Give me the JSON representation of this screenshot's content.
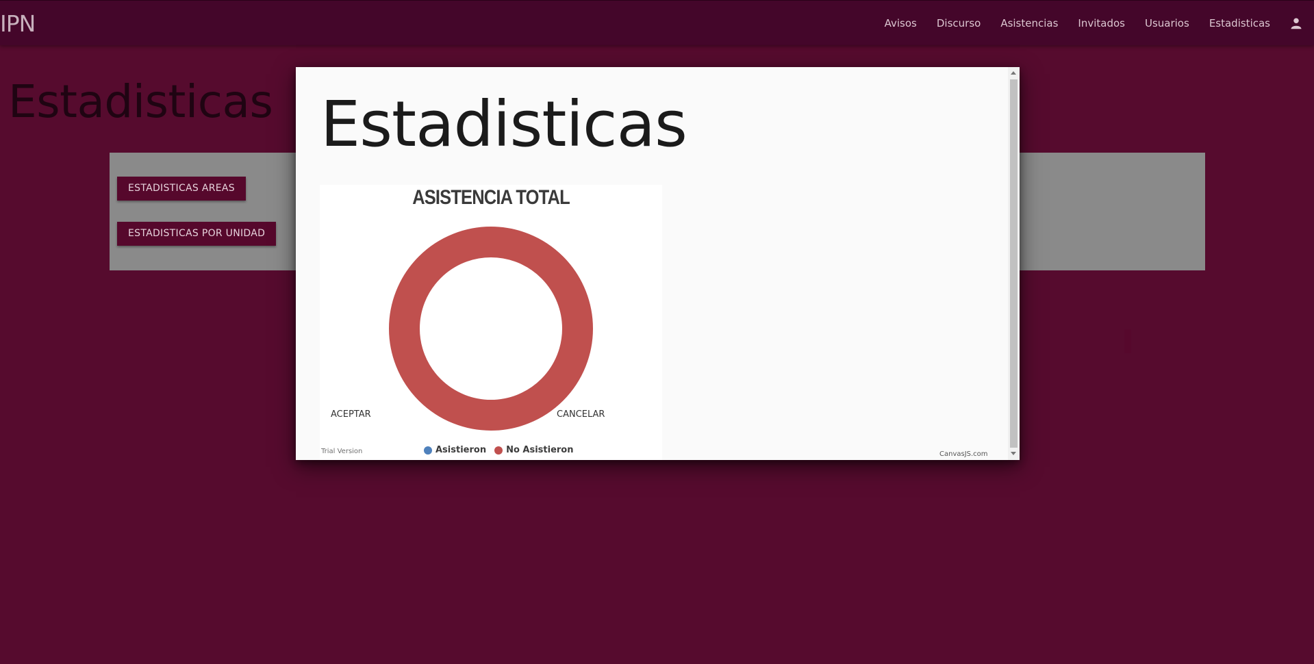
{
  "navbar": {
    "brand": "IPN",
    "links": [
      {
        "label": "Avisos"
      },
      {
        "label": "Discurso"
      },
      {
        "label": "Asistencias"
      },
      {
        "label": "Invitados"
      },
      {
        "label": "Usuarios"
      },
      {
        "label": "Estadisticas"
      }
    ],
    "user_icon": "person-icon"
  },
  "page": {
    "title": "Estadisticas",
    "buttons": {
      "areas": "ESTADISTICAS AREAS",
      "unidad": "ESTADISTICAS POR UNIDAD"
    }
  },
  "modal": {
    "title": "Estadisticas",
    "accept": "ACEPTAR",
    "cancel": "CANCELAR",
    "trial": "Trial Version",
    "credit": "CanvasJS.com"
  },
  "chart_data": {
    "type": "pie",
    "subtype": "doughnut",
    "title": "ASISTENCIA TOTAL",
    "labels": [
      "Asistieron",
      "No Asistieron"
    ],
    "values": [
      0,
      1
    ],
    "colors": [
      "#4f81bc",
      "#c0504e"
    ],
    "legend": "bottom"
  },
  "colors": {
    "background": "#560b2e",
    "navbar": "#44062a",
    "button": "#56082c",
    "card": "#8a8a8a"
  }
}
